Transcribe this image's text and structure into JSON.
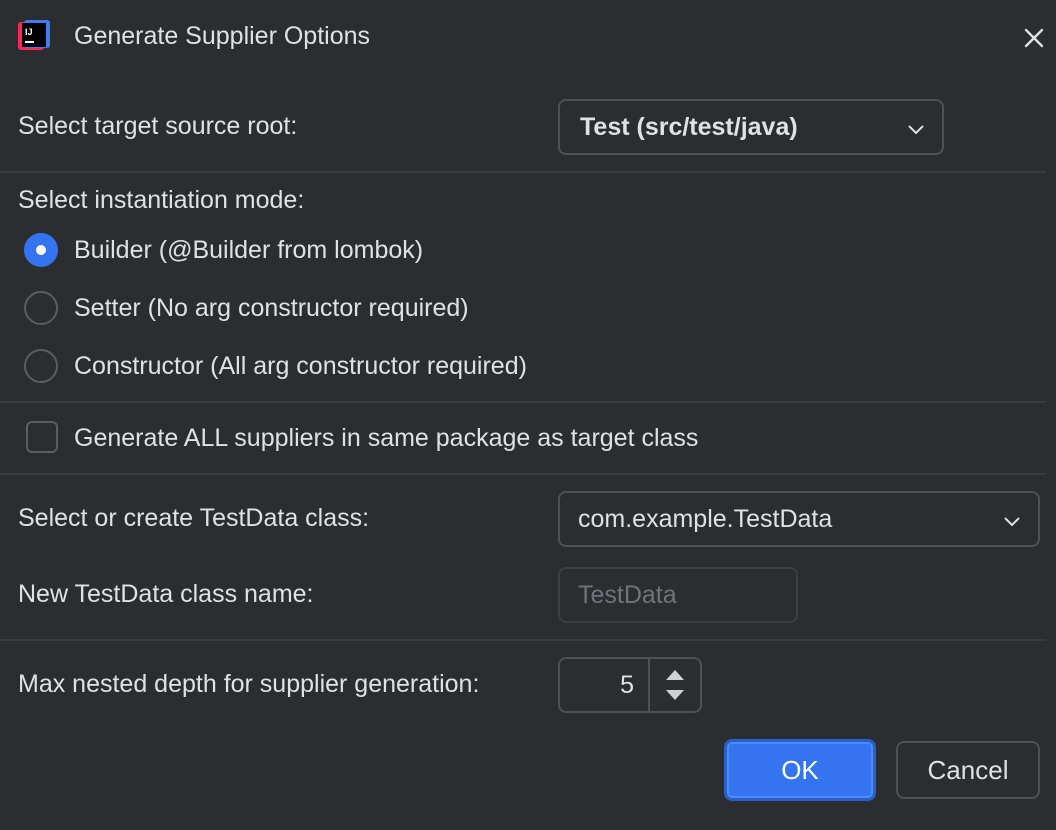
{
  "window": {
    "title": "Generate Supplier Options"
  },
  "source_root": {
    "label": "Select target source root:",
    "selected": "Test (src/test/java)"
  },
  "instantiation": {
    "label": "Select instantiation mode:",
    "options": [
      {
        "label": "Builder (@Builder from lombok)",
        "checked": true
      },
      {
        "label": "Setter (No arg constructor required)",
        "checked": false
      },
      {
        "label": "Constructor (All arg constructor required)",
        "checked": false
      }
    ]
  },
  "same_package": {
    "label": "Generate ALL suppliers in same package as target class",
    "checked": false
  },
  "testdata_class": {
    "label": "Select or create TestData class:",
    "selected": "com.example.TestData"
  },
  "new_class_name": {
    "label": "New TestData class name:",
    "placeholder": "TestData",
    "value": ""
  },
  "max_depth": {
    "label": "Max nested depth for supplier generation:",
    "value": "5"
  },
  "buttons": {
    "ok": "OK",
    "cancel": "Cancel"
  },
  "colors": {
    "background": "#2b2d30",
    "accent": "#3574f0",
    "text": "#dfe1e5",
    "border": "#4e5157"
  }
}
